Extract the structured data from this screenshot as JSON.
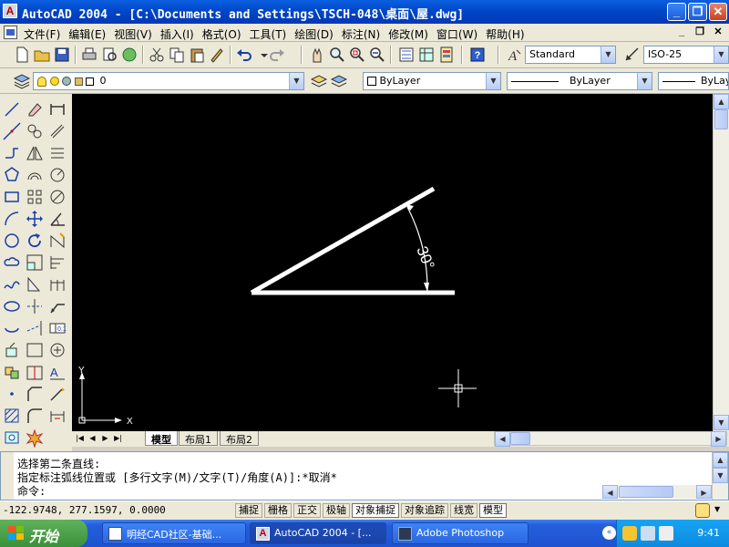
{
  "window": {
    "title": "AutoCAD 2004 - [C:\\Documents and Settings\\TSCH-048\\桌面\\屋.dwg]"
  },
  "menu": [
    "文件(F)",
    "编辑(E)",
    "视图(V)",
    "插入(I)",
    "格式(O)",
    "工具(T)",
    "绘图(D)",
    "标注(N)",
    "修改(M)",
    "窗口(W)",
    "帮助(H)"
  ],
  "toolbar": {
    "text_style": "Standard",
    "dim_style": "ISO-25",
    "layer": "0",
    "color": "ByLayer",
    "linetype": "ByLayer",
    "lineweight": "ByLayer"
  },
  "drawing": {
    "dimension_text": "30°",
    "angle_degrees": 30
  },
  "ucs": {
    "x_label": "X",
    "y_label": "Y"
  },
  "tabs": [
    "模型",
    "布局1",
    "布局2"
  ],
  "command": {
    "line1": "选择第二条直线:",
    "line2": "指定标注弧线位置或 [多行文字(M)/文字(T)/角度(A)]:*取消*",
    "prompt": "命令:"
  },
  "status": {
    "coords": "-122.9748, 277.1597, 0.0000",
    "buttons": [
      {
        "label": "捕捉",
        "on": false
      },
      {
        "label": "栅格",
        "on": false
      },
      {
        "label": "正交",
        "on": false
      },
      {
        "label": "极轴",
        "on": false
      },
      {
        "label": "对象捕捉",
        "on": true
      },
      {
        "label": "对象追踪",
        "on": false
      },
      {
        "label": "线宽",
        "on": false
      },
      {
        "label": "模型",
        "on": true
      }
    ]
  },
  "taskbar": {
    "start": "开始",
    "tasks": [
      "明经CAD社区-基础...",
      "AutoCAD 2004 - [...",
      "Adobe Photoshop"
    ],
    "clock": "9:41"
  },
  "colors": {
    "canvas": "#000000",
    "titlebar": "#0a5fe0",
    "taskbar": "#245edb",
    "start": "#3c8f3a"
  }
}
